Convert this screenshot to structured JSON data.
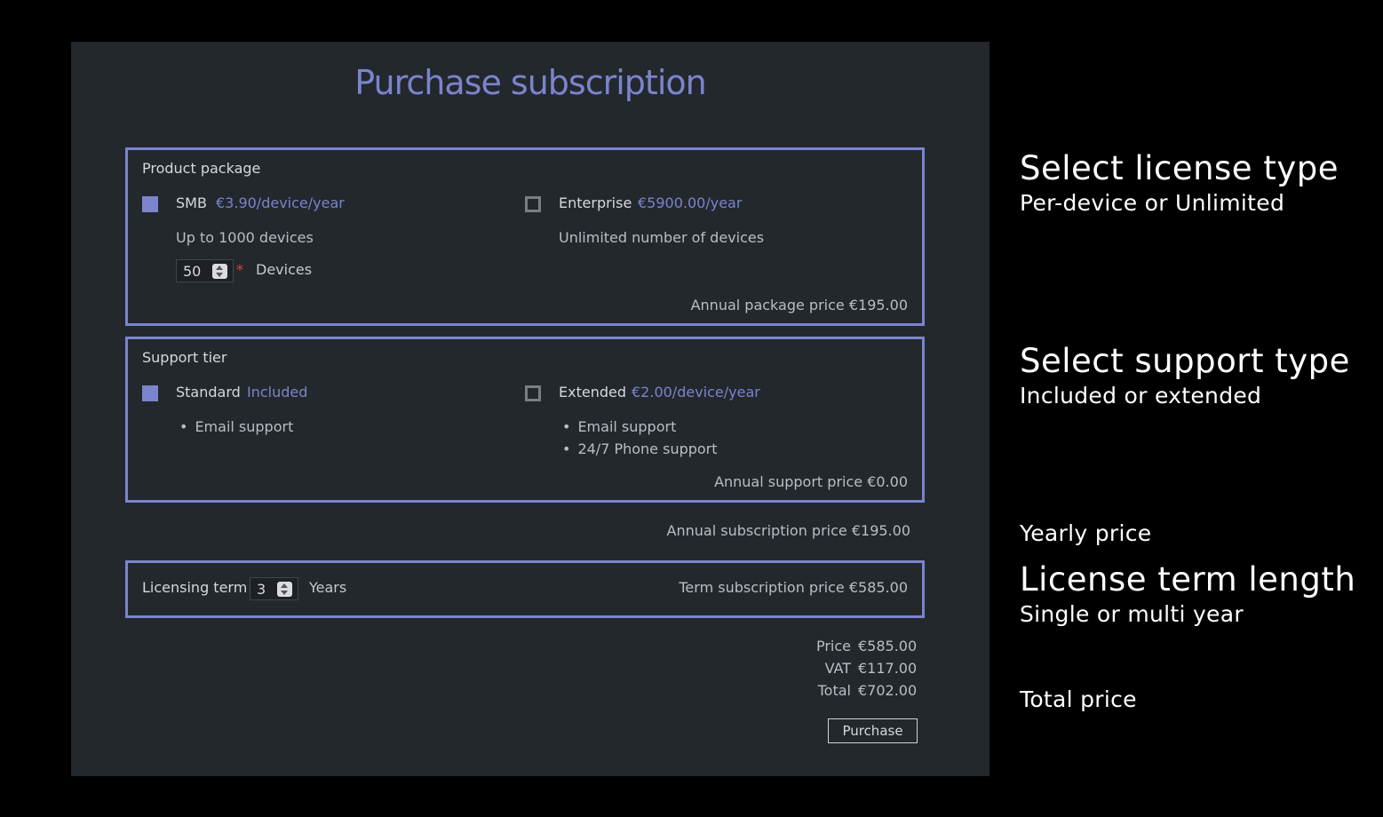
{
  "title": "Purchase subscription",
  "colors": {
    "accent": "#7b84cc",
    "panel": "#23282d",
    "required": "#e0443a"
  },
  "package": {
    "label": "Product package",
    "smb": {
      "name": "SMB",
      "price": "€3.90/device/year",
      "desc": "Up to 1000 devices",
      "checked": true
    },
    "enterprise": {
      "name": "Enterprise",
      "price": "€5900.00/year",
      "desc": "Unlimited number of devices",
      "checked": false
    },
    "devices_value": "50",
    "required_mark": "*",
    "devices_label": "Devices",
    "annual_price": "Annual package price €195.00"
  },
  "support": {
    "label": "Support tier",
    "standard": {
      "name": "Standard",
      "price": "Included",
      "features": [
        "Email support"
      ],
      "checked": true
    },
    "extended": {
      "name": "Extended",
      "price": "€2.00/device/year",
      "features": [
        "Email support",
        "24/7 Phone support"
      ],
      "checked": false
    },
    "annual_price": "Annual support price €0.00"
  },
  "annual_subscription": "Annual subscription price €195.00",
  "term": {
    "label": "Licensing term",
    "value": "3",
    "unit": "Years",
    "price": "Term subscription price €585.00"
  },
  "totals": {
    "price_label": "Price",
    "price": "€585.00",
    "vat_label": "VAT",
    "vat": "€117.00",
    "total_label": "Total",
    "total": "€702.00"
  },
  "purchase_label": "Purchase",
  "annotations": {
    "license_title": "Select license type",
    "license_sub": "Per-device or Unlimited",
    "support_title": "Select support type",
    "support_sub": "Included or extended",
    "yearly": "Yearly price",
    "term_title": "License term length",
    "term_sub": "Single or multi year",
    "total": "Total price"
  }
}
